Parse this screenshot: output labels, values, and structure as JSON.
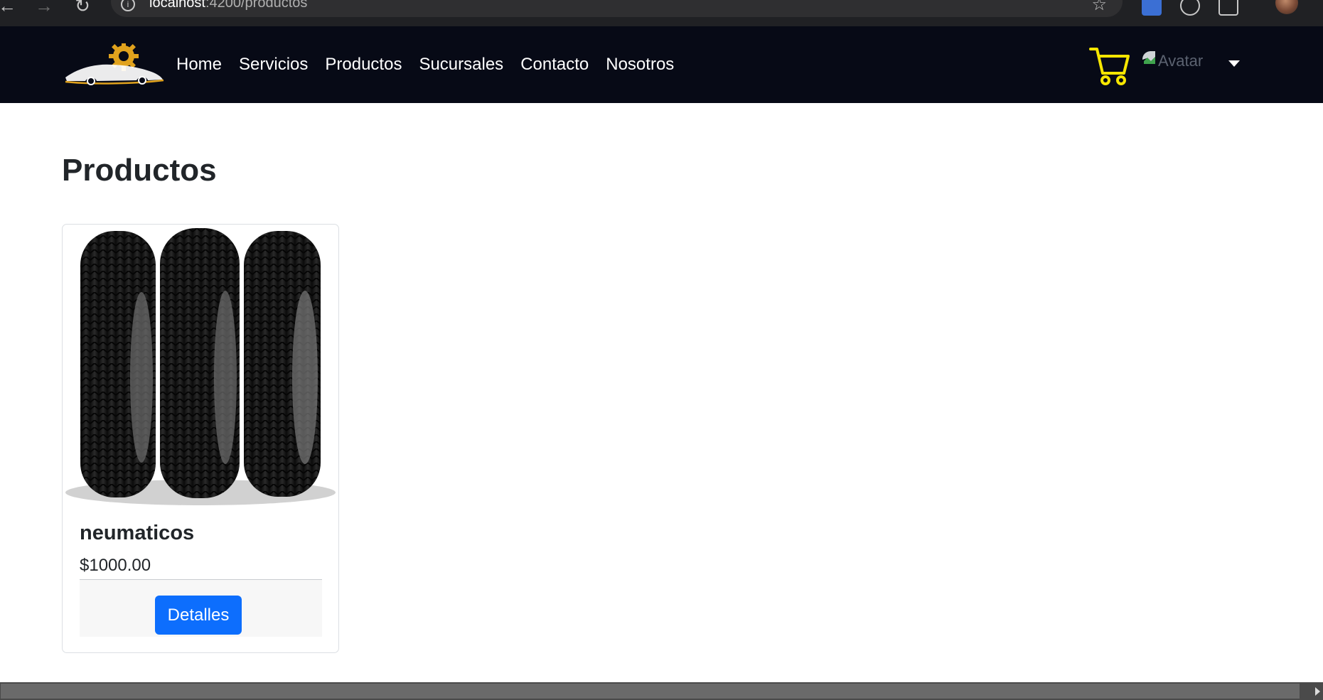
{
  "browser": {
    "url_host": "localhost",
    "url_path": ":4200/productos"
  },
  "navbar": {
    "links": [
      "Home",
      "Servicios",
      "Productos",
      "Sucursales",
      "Contacto",
      "Nosotros"
    ],
    "avatar_alt": "Avatar",
    "cart_color": "#f6e600",
    "background": "#070a16"
  },
  "main": {
    "title": "Productos",
    "products": [
      {
        "name": "neumaticos",
        "price": "$1000.00",
        "button_label": "Detalles",
        "image_icon": "tires-image"
      }
    ]
  },
  "colors": {
    "primary_button": "#0d6efd"
  }
}
